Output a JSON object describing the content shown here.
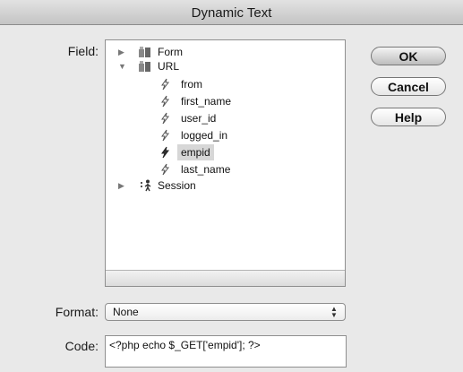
{
  "window": {
    "title": "Dynamic Text"
  },
  "labels": {
    "field": "Field:",
    "format": "Format:",
    "code": "Code:"
  },
  "tree": {
    "form": {
      "label": "Form",
      "icon": "database-icon",
      "expanded": false
    },
    "url": {
      "label": "URL",
      "icon": "database-icon",
      "expanded": true,
      "children": [
        {
          "label": "from",
          "icon": "lightning-icon"
        },
        {
          "label": "first_name",
          "icon": "lightning-icon"
        },
        {
          "label": "user_id",
          "icon": "lightning-icon"
        },
        {
          "label": "logged_in",
          "icon": "lightning-icon"
        },
        {
          "label": "empid",
          "icon": "lightning-icon",
          "selected": true
        },
        {
          "label": "last_name",
          "icon": "lightning-icon"
        }
      ]
    },
    "session": {
      "label": "Session",
      "icon": "person-icon",
      "expanded": false
    }
  },
  "buttons": {
    "ok": "OK",
    "cancel": "Cancel",
    "help": "Help"
  },
  "format": {
    "value": "None"
  },
  "code": {
    "value": "<?php echo $_GET['empid']; ?>"
  }
}
